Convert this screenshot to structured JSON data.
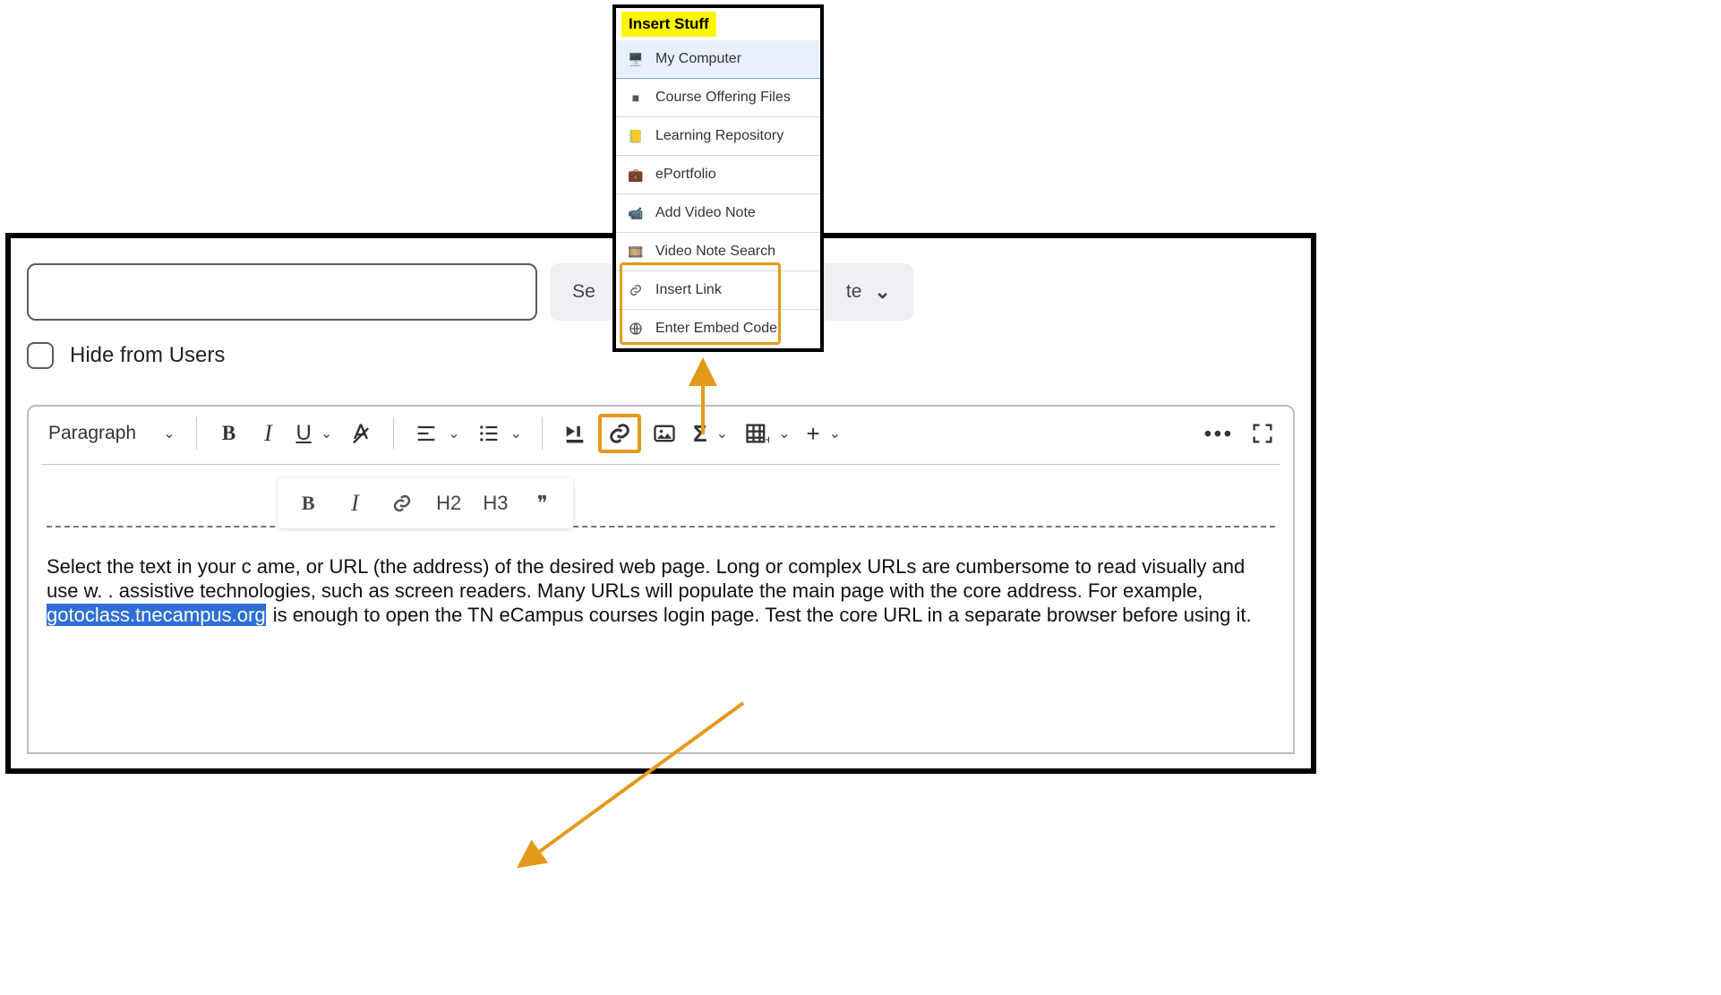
{
  "popup": {
    "title": "Insert Stuff",
    "items": [
      {
        "label": "My Computer",
        "icon": "monitor-icon",
        "selected": true
      },
      {
        "label": "Course Offering Files",
        "icon": "folder-icon",
        "selected": false
      },
      {
        "label": "Learning Repository",
        "icon": "book-icon",
        "selected": false
      },
      {
        "label": "ePortfolio",
        "icon": "briefcase-icon",
        "selected": false
      },
      {
        "label": "Add Video Note",
        "icon": "camera-icon",
        "selected": false
      },
      {
        "label": "Video Note Search",
        "icon": "film-icon",
        "selected": false
      },
      {
        "label": "Insert Link",
        "icon": "link-icon",
        "selected": false
      },
      {
        "label": "Enter Embed Code",
        "icon": "globe-icon",
        "selected": false
      }
    ]
  },
  "top": {
    "template_label_visible": "Se                                                te",
    "hide_label": "Hide from Users"
  },
  "toolbar": {
    "para_label": "Paragraph"
  },
  "mini": {
    "bold": "B",
    "italic": "I",
    "h2": "H2",
    "h3": "H3",
    "quote": "❞"
  },
  "body": {
    "pre": "Select the text in your c                                                               ame, or URL (the address) of the desired web page. Long or complex URLs are cumbersome to read visually and use w. . assistive technologies, such as screen readers. Many URLs will populate the main page with the core address. For example, ",
    "highlight": "gotoclass.tnecampus.org",
    "post": " is enough to open the TN eCampus courses login page. Test the core URL in a separate browser before using it."
  }
}
